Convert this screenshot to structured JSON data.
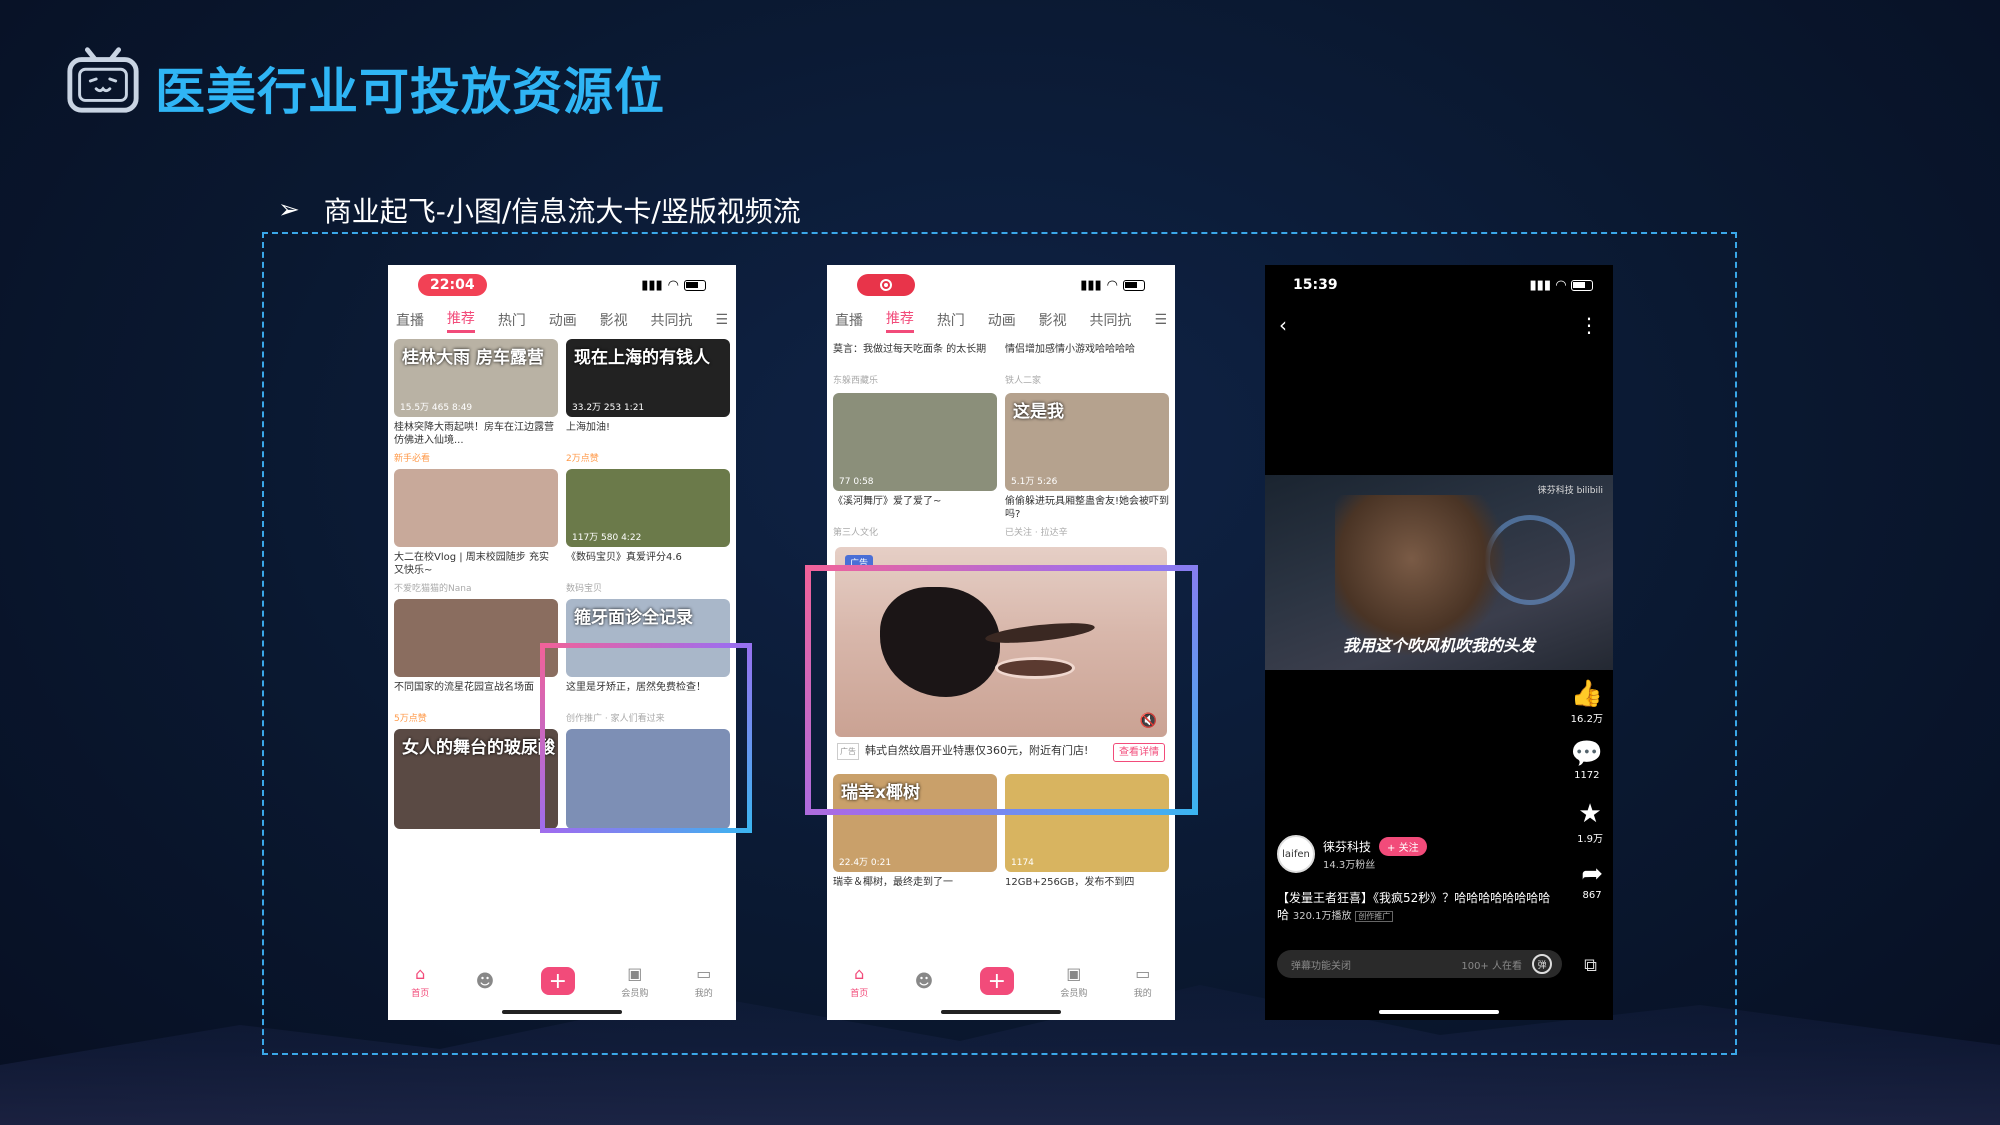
{
  "slide": {
    "title": "医美行业可投放资源位",
    "subtitle": "商业起飞-小图/信息流大卡/竖版视频流",
    "bullet_arrow": "➢",
    "colors": {
      "title": "#2fb5f5",
      "frame": "#3aa7e8",
      "accent": "#f24b7a"
    }
  },
  "phone1": {
    "time": "22:04",
    "tabs": [
      "直播",
      "推荐",
      "热门",
      "动画",
      "影视",
      "共同抗",
      "☰"
    ],
    "active_tab": "推荐",
    "cards": [
      {
        "overlay": "桂林大雨 房车露营",
        "stats": "15.5万  465  8:49",
        "caption": "桂林突降大雨起哄！房车在江边露营仿佛进入仙境...",
        "meta": "新手必看",
        "hot": true,
        "bg": "#b9b2a4"
      },
      {
        "overlay": "现在上海的有钱人",
        "stats": "33.2万  253  1:21",
        "caption": "上海加油!",
        "meta": "2万点赞",
        "hot": true,
        "bg": "#222"
      },
      {
        "overlay": "",
        "stats": "",
        "caption": "大二在校Vlog | 周末校园随步 充实又快乐~",
        "meta": "不爱吃猫猫的Nana",
        "hot": false,
        "bg": "#c8a99a"
      },
      {
        "overlay": "",
        "stats": "117万  580  4:22",
        "caption": "《数码宝贝》真爱评分4.6",
        "meta": "数码宝贝",
        "hot": false,
        "bg": "#6b7a4a"
      },
      {
        "overlay": "",
        "stats": "",
        "caption": "不同国家的流星花园宣战名场面",
        "meta": "5万点赞",
        "hot": true,
        "bg": "#8a6d5f"
      },
      {
        "overlay": "箍牙面诊全记录",
        "stats": "",
        "caption": "这里是牙矫正，居然免费检查！",
        "meta": "创作推广 · 家人们看过来",
        "hot": false,
        "bg": "#a9b7c9"
      },
      {
        "overlay": "女人的舞台的玻尿酸",
        "stats": "",
        "caption": "",
        "meta": "",
        "hot": false,
        "bg": "#5a4a44"
      },
      {
        "overlay": "",
        "stats": "",
        "caption": "",
        "meta": "",
        "hot": false,
        "bg": "#7d8fb5"
      }
    ],
    "nav": [
      "首页",
      "",
      "+",
      "会员购",
      "我的"
    ]
  },
  "phone2": {
    "tabs": [
      "直播",
      "推荐",
      "热门",
      "动画",
      "影视",
      "共同抗",
      "☰"
    ],
    "active_tab": "推荐",
    "top_cards": [
      {
        "caption": "莫言：我做过每天吃面条 的太长期",
        "meta": "东躲西藏乐"
      },
      {
        "caption": "情侣增加感情小游戏哈哈哈哈",
        "meta": "铁人二家"
      }
    ],
    "mid_cards": [
      {
        "overlay": "",
        "stats": "77  0:58",
        "caption": "《溪河舞厅》爱了爱了~",
        "meta": "第三人文化",
        "bg": "#8b8f7a"
      },
      {
        "overlay": "这是我",
        "stats": "5.1万  5:26",
        "caption": "偷偷躲进玩具厢整蛊舍友!她会被吓到吗?",
        "meta": "已关注 · 拉达辛",
        "bg": "#b5a28e"
      }
    ],
    "ad": {
      "tag": "广告",
      "text": "韩式自然纹眉开业特惠仅360元，附近有门店!",
      "button": "查看详情",
      "mute": "🔇"
    },
    "bottom_cards": [
      {
        "overlay": "瑞幸x椰树",
        "stats": "22.4万  0:21",
        "caption": "瑞幸＆椰树，最终走到了一",
        "bg": "#c9a06a"
      },
      {
        "overlay": "",
        "stats": "1174",
        "caption": "12GB+256GB，发布不到四",
        "bg": "#d8b460"
      }
    ],
    "nav": [
      "首页",
      "",
      "+",
      "会员购",
      "我的"
    ]
  },
  "phone3": {
    "time": "15:39",
    "back": "‹",
    "more": "⋮",
    "subtitle": "我用这个吹风机吹我的头发",
    "watermark": "徕芬科技  bilibili",
    "likes": "16.2万",
    "comments": "1172",
    "favorites": "1.9万",
    "shares": "867",
    "author": "徕芬科技",
    "avatar_text": "laifen",
    "follow": "+ 关注",
    "fans": "14.3万粉丝",
    "desc": "【发量王者狂喜】《我疯52秒》？哈哈哈哈哈哈哈哈哈",
    "plays": "320.1万播放",
    "promo": "创作推广",
    "danmu": "弹幕功能关闭",
    "watching": "100+ 人在看",
    "danmu_icon": "弹"
  }
}
